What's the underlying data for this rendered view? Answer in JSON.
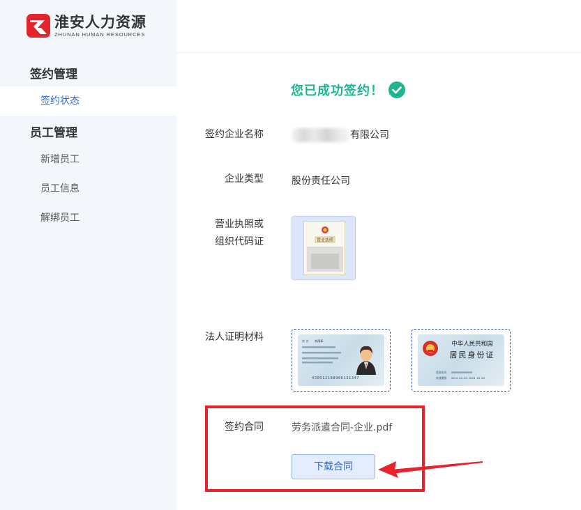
{
  "brand": {
    "name_cn": "淮安人力资源",
    "name_en": "ZHUNAN HUMAN RESOURCES",
    "logo_icon": "brand-logo-icon",
    "logo_color": "#e3262d"
  },
  "sidebar": {
    "groups": [
      {
        "label": "签约管理",
        "items": [
          {
            "label": "签约状态",
            "active": true
          }
        ]
      },
      {
        "label": "员工管理",
        "items": [
          {
            "label": "新增员工"
          },
          {
            "label": "员工信息"
          },
          {
            "label": "解绑员工"
          }
        ]
      }
    ]
  },
  "main": {
    "success_message": "您已成功签约！",
    "success_icon": "check-circle-icon",
    "success_color": "#1fb58f",
    "fields": {
      "company_name_label": "签约企业名称",
      "company_name_suffix": "有限公司",
      "company_type_label": "企业类型",
      "company_type_value": "股份责任公司",
      "license_label_line1": "营业执照或",
      "license_label_line2": "组织代码证",
      "legal_label": "法人证明材料",
      "contract_label": "签约合同",
      "contract_file": "劳务派遣合同-企业.pdf",
      "license_doc_title": "营业执照"
    },
    "id_card_front": {
      "number": "430512198906131347",
      "name_label": "姓 名",
      "name_value": "刘雨禾"
    },
    "id_card_back": {
      "title_line1": "中华人民共和国",
      "title_line2": "居民身份证",
      "issuer_label": "签发机关",
      "valid_label": "有效期限",
      "valid_value": "2013.03.03-2023.03.03"
    },
    "download_button": "下载合同",
    "highlight_color": "#e9232e",
    "accent_color": "#2d6ae0"
  }
}
